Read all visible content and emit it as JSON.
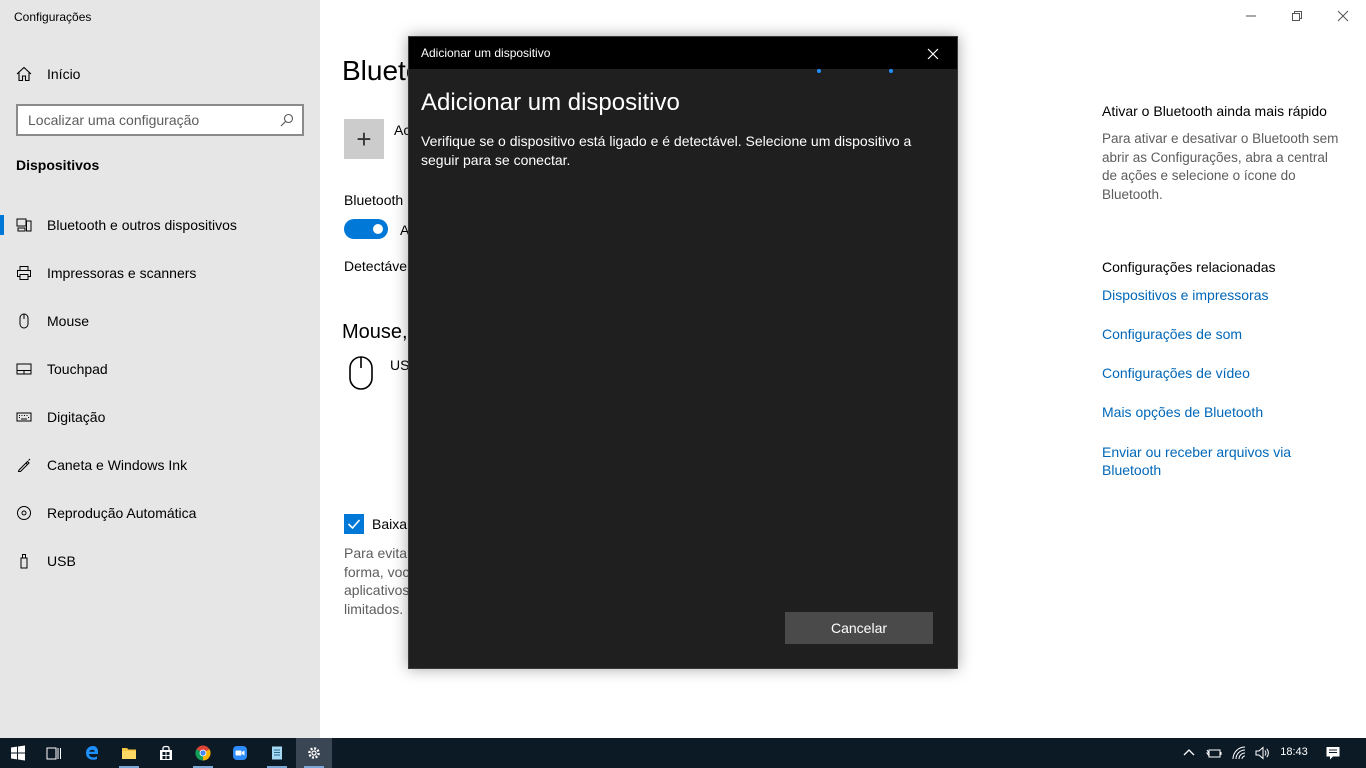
{
  "app": {
    "title": "Configurações"
  },
  "sidebar": {
    "home_label": "Início",
    "search_placeholder": "Localizar uma configuração",
    "section": "Dispositivos",
    "items": [
      {
        "label": "Bluetooth e outros dispositivos",
        "icon": "bluetooth-devices-icon",
        "active": true
      },
      {
        "label": "Impressoras e scanners",
        "icon": "printer-icon"
      },
      {
        "label": "Mouse",
        "icon": "mouse-icon"
      },
      {
        "label": "Touchpad",
        "icon": "touchpad-icon"
      },
      {
        "label": "Digitação",
        "icon": "keyboard-icon"
      },
      {
        "label": "Caneta e Windows Ink",
        "icon": "pen-icon"
      },
      {
        "label": "Reprodução Automática",
        "icon": "autoplay-icon"
      },
      {
        "label": "USB",
        "icon": "usb-icon"
      }
    ]
  },
  "main": {
    "title": "Blueto",
    "add_label": "Ac",
    "bluetooth_label": "Bluetooth",
    "toggle_label": "A",
    "detect_label": "Detectável",
    "mouse_heading": "Mouse,",
    "usb_label": "US",
    "checkbox_label": "Baixar",
    "note": "Para evitar forma, voc aplicativos limitados."
  },
  "right": {
    "fast_title": "Ativar o Bluetooth ainda mais rápido",
    "fast_desc": "Para ativar e desativar o Bluetooth sem abrir as Configurações, abra a central de ações e selecione o ícone do Bluetooth.",
    "related_title": "Configurações relacionadas",
    "links": [
      "Dispositivos e impressoras",
      "Configurações de som",
      "Configurações de vídeo",
      "Mais opções de Bluetooth",
      "Enviar ou receber arquivos via Bluetooth"
    ]
  },
  "dialog": {
    "window_title": "Adicionar um dispositivo",
    "heading": "Adicionar um dispositivo",
    "description": "Verifique se o dispositivo está ligado e é detectável. Selecione um dispositivo a seguir para se conectar.",
    "cancel_label": "Cancelar"
  },
  "taskbar": {
    "apps": [
      "start-icon",
      "task-view-icon",
      "edge-icon",
      "file-explorer-icon",
      "store-icon",
      "chrome-icon",
      "zoom-icon",
      "notepad-icon",
      "settings-icon"
    ],
    "clock": "18:43"
  },
  "colors": {
    "accent": "#0078d7",
    "link": "#0067b8",
    "dialog_bg": "#1f1f1f",
    "taskbar_bg": "#0c1a26"
  }
}
